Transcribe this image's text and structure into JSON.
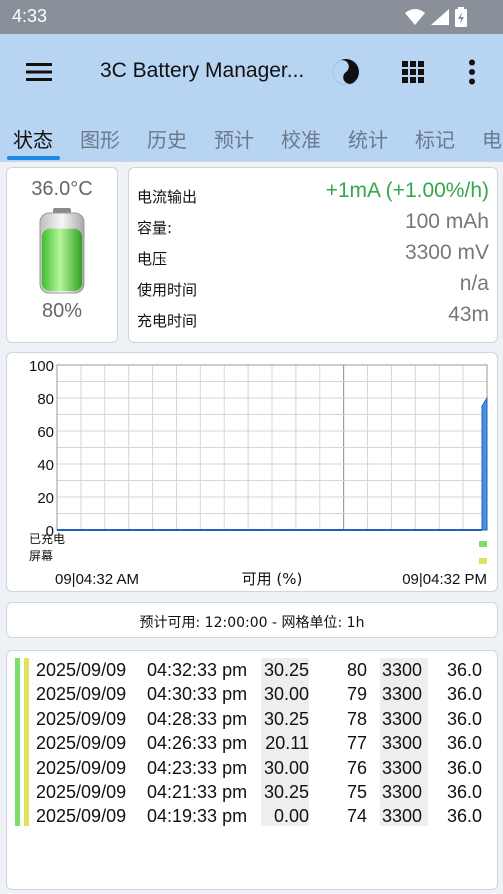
{
  "status_bar": {
    "time": "4:33"
  },
  "app_bar": {
    "title": "3C Battery Manager...",
    "menu_icon": "hamburger-menu-icon",
    "actions": [
      "yin-yang-icon",
      "grid-apps-icon",
      "more-vert-icon"
    ]
  },
  "tabs": [
    {
      "label": "状态",
      "active": true
    },
    {
      "label": "图形",
      "active": false
    },
    {
      "label": "历史",
      "active": false
    },
    {
      "label": "预计",
      "active": false
    },
    {
      "label": "校准",
      "active": false
    },
    {
      "label": "统计",
      "active": false
    },
    {
      "label": "标记",
      "active": false
    },
    {
      "label": "电",
      "active": false
    }
  ],
  "battery": {
    "temperature": "36.0°C",
    "level": "80%",
    "level_fraction": 0.8
  },
  "info": [
    {
      "label": "电流输出",
      "value": "+1mA (+1.00%/h)",
      "color": "#33a84a"
    },
    {
      "label": "容量:",
      "value": "100 mAh",
      "color": "#777777"
    },
    {
      "label": "电压",
      "value": "3300 mV",
      "color": "#777777"
    },
    {
      "label": "使用时间",
      "value": "n/a",
      "color": "#777777"
    },
    {
      "label": "充电时间",
      "value": "43m",
      "color": "#777777"
    }
  ],
  "chart": {
    "y_ticks": [
      "100",
      "80",
      "60",
      "40",
      "20",
      "0"
    ],
    "row_labels": [
      "已充电",
      "屏幕"
    ],
    "x_start": "09|04:32 AM",
    "x_label": "可用 (%)",
    "x_end": "09|04:32 PM"
  },
  "chart_data": {
    "type": "area",
    "ylim": [
      0,
      100
    ],
    "x": [
      "09|04:32 AM",
      "09|04:32 PM"
    ],
    "series": [
      {
        "values": [
          0,
          0,
          75,
          80
        ],
        "color": "#4a90e2"
      }
    ],
    "grid": true,
    "xlabel": "可用 (%)",
    "ylabel": ""
  },
  "forecast": {
    "text": "预计可用:  12:00:00 - 网格单位:  1h"
  },
  "log": {
    "rows": [
      {
        "date": "2025/09/09",
        "time": "04:32:33 pm",
        "rate": "30.25",
        "level": "80",
        "voltage": "3300",
        "temp": "36.0"
      },
      {
        "date": "2025/09/09",
        "time": "04:30:33 pm",
        "rate": "30.00",
        "level": "79",
        "voltage": "3300",
        "temp": "36.0"
      },
      {
        "date": "2025/09/09",
        "time": "04:28:33 pm",
        "rate": "30.25",
        "level": "78",
        "voltage": "3300",
        "temp": "36.0"
      },
      {
        "date": "2025/09/09",
        "time": "04:26:33 pm",
        "rate": "20.11",
        "level": "77",
        "voltage": "3300",
        "temp": "36.0"
      },
      {
        "date": "2025/09/09",
        "time": "04:23:33 pm",
        "rate": "30.00",
        "level": "76",
        "voltage": "3300",
        "temp": "36.0"
      },
      {
        "date": "2025/09/09",
        "time": "04:21:33 pm",
        "rate": "30.25",
        "level": "75",
        "voltage": "3300",
        "temp": "36.0"
      },
      {
        "date": "2025/09/09",
        "time": "04:19:33 pm",
        "rate": "0.00",
        "level": "74",
        "voltage": "3300",
        "temp": "36.0"
      }
    ]
  },
  "colors": {
    "accent": "#1e88e5",
    "appbar": "#b7d4f3",
    "charge_green": "#7be06b",
    "screen_yellow": "#dfe35a"
  }
}
